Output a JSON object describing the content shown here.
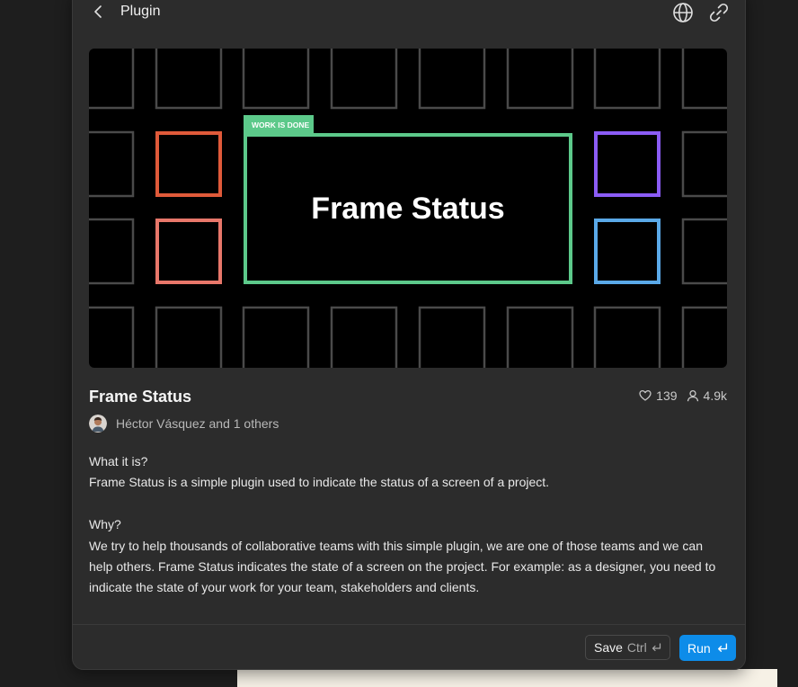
{
  "header": {
    "title": "Plugin",
    "back_icon": "chevron-left-icon",
    "globe_icon": "globe-icon",
    "link_icon": "link-icon"
  },
  "hero": {
    "badge": "WORK IS DONE",
    "headline": "Frame Status",
    "colors": {
      "background": "#000000",
      "grid_stroke": "#4a4a4a",
      "main_frame": "#5cc98a",
      "orange": "#e05a3a",
      "salmon": "#e8776a",
      "purple": "#8b5cf6",
      "blue": "#5aa9e8"
    }
  },
  "plugin": {
    "name": "Frame Status",
    "likes": "139",
    "users": "4.9k",
    "author": "Héctor Vásquez and 1 others"
  },
  "description": {
    "q1": "What it is?",
    "a1": "Frame Status is a simple plugin used to indicate the status of a screen of a project.",
    "q2": "Why?",
    "a2": "We try to help thousands of collaborative teams with this simple plugin, we are one of those teams and we can help others. Frame Status indicates the state of a screen on the project. For example: as a designer, you need to indicate the state of your work for your team, stakeholders and clients."
  },
  "footer": {
    "save_label": "Save",
    "save_shortcut": "Ctrl",
    "run_label": "Run",
    "accent": "#0d8ce9"
  }
}
